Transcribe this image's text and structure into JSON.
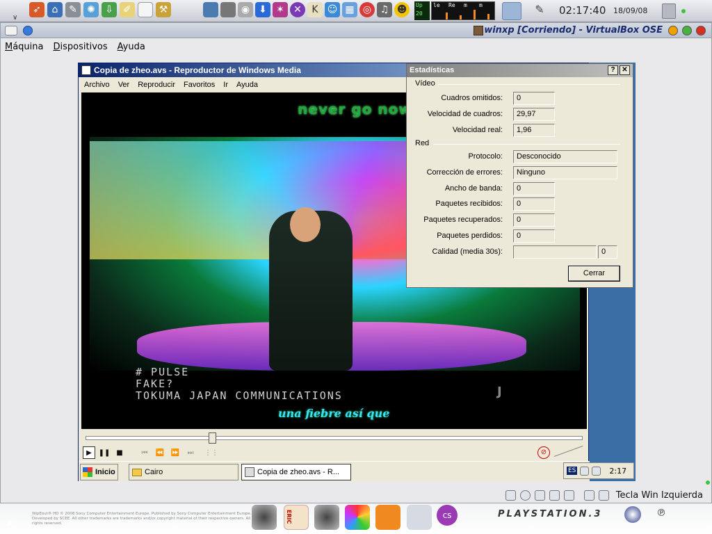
{
  "host_panel": {
    "clock_time": "02:17:40",
    "clock_date": "18/09/08",
    "netmon_labels": [
      "Up",
      "20"
    ],
    "sysmon_labels": [
      "le",
      "Re",
      "m",
      "m"
    ]
  },
  "vbox": {
    "title": "winxp [Corriendo] - VirtualBox OSE",
    "menu": [
      "Máquina",
      "Dispositivos",
      "Ayuda"
    ],
    "host_key_label": "Tecla Win Izquierda"
  },
  "wmp": {
    "title": "Copia de zheo.avs - Reproductor de Windows Media",
    "menu": [
      "Archivo",
      "Ver",
      "Reproducir",
      "Favoritos",
      "Ir",
      "Ayuda"
    ],
    "video": {
      "lyric_top": "never go now",
      "credit_lines": [
        "# PULSE",
        "FAKE?",
        "TOKUMA JAPAN COMMUNICATIONS"
      ],
      "lyric_bottom": "una fiebre así que"
    },
    "seek_position": 0.25
  },
  "stats": {
    "title": "Estadísticas",
    "help_btn": "?",
    "close_x": "✕",
    "video_group": "Vídeo",
    "network_group": "Red",
    "video_rows": [
      {
        "label": "Cuadros omitidos:",
        "value": "0"
      },
      {
        "label": "Velocidad de cuadros:",
        "value": "29,97"
      },
      {
        "label": "Velocidad real:",
        "value": "1,96"
      }
    ],
    "network_rows": [
      {
        "label": "Protocolo:",
        "value": "Desconocido"
      },
      {
        "label": "Corrección de errores:",
        "value": "Ninguno"
      },
      {
        "label": "Ancho de banda:",
        "value": "0"
      },
      {
        "label": "Paquetes recibidos:",
        "value": "0"
      },
      {
        "label": "Paquetes recuperados:",
        "value": "0"
      },
      {
        "label": "Paquetes perdidos:",
        "value": "0"
      }
    ],
    "quality_label": "Calidad (media 30s):",
    "quality_value": "0",
    "close_button": "Cerrar"
  },
  "xp_taskbar": {
    "start": "Inicio",
    "tasks": [
      "Cairo",
      "Copia de zheo.avs - R..."
    ],
    "lang": "ES",
    "time": "2:17"
  },
  "dock": {
    "legal_text": "WipEout® HD © 2008 Sony Computer Entertainment Europe. Published by Sony Computer Entertainment Europe. Developed by SCEE. All other trademarks are trademarks and/or copyright material of their respective owners. All rights reserved.",
    "eric_label": "ERIC",
    "ps3_label": "PLAYSTATION.3"
  },
  "colors": {
    "xp_title": "#0a246a",
    "vbox_title_text": "#1a2a6e",
    "desktop_blue": "#3a6ea5"
  }
}
